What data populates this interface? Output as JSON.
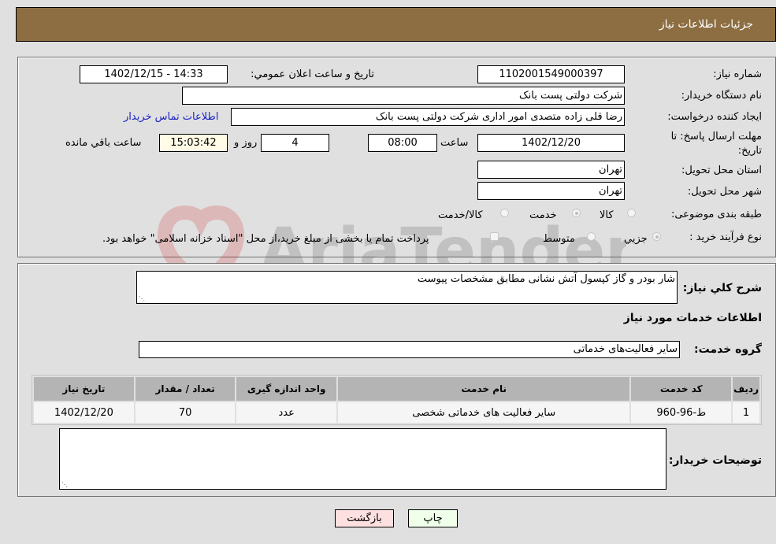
{
  "header": {
    "title": "جزئیات اطلاعات نیاز"
  },
  "form": {
    "need_number": {
      "label": "شماره نیاز:",
      "value": "1102001549000397"
    },
    "announce_datetime": {
      "label": "تاریخ و ساعت اعلان عمومي:",
      "value": "1402/12/15 - 14:33"
    },
    "buyer_org": {
      "label": "نام دستگاه خريدار:",
      "value": "شركت دولتی پست بانک"
    },
    "requester": {
      "label": "ایجاد کننده درخواست:",
      "value": "رضا قلی زاده متصدی امور اداری شرکت دولتی پست بانک"
    },
    "buyer_contact_link": "اطلاعات تماس خريدار",
    "deadline": {
      "label": "مهلت ارسال پاسخ: تا تاریخ:",
      "date": "1402/12/20",
      "time_label": "ساعت",
      "time": "08:00",
      "days": "4",
      "days_label": "روز و",
      "remaining": "15:03:42",
      "remaining_label": "ساعت باقي مانده"
    },
    "delivery_province": {
      "label": "استان محل تحويل:",
      "value": "تهران"
    },
    "delivery_city": {
      "label": "شهر محل تحويل:",
      "value": "تهران"
    },
    "category": {
      "label": "طبقه بندی موضوعی:",
      "options": [
        "کالا",
        "خدمت",
        "کالا/خدمت"
      ],
      "selected": "خدمت"
    },
    "purchase_type": {
      "label": "نوع فرآیند خرید :",
      "options": [
        "جزيي",
        "متوسط"
      ],
      "selected": "جزيي",
      "treasury_note": "پرداخت تمام یا بخشی از مبلغ خرید،از محل \"اسناد خزانه اسلامی\" خواهد بود.",
      "treasury_checked": false
    }
  },
  "details": {
    "description_label": "شرح کلي نياز:",
    "description_value": "شار بودر و گاز کپسول آتش نشانی مطابق مشخصات پیوست",
    "services_heading": "اطلاعات خدمات مورد نیاز",
    "service_group_label": "گروه خدمت:",
    "service_group_value": "سایر فعالیت‌های خدماتی",
    "table": {
      "headers": [
        "ردیف",
        "کد خدمت",
        "نام خدمت",
        "واحد اندازه گیری",
        "تعداد / مقدار",
        "تاریخ نیاز"
      ],
      "rows": [
        [
          "1",
          "ط-96-960",
          "سایر فعالیت های خدماتی شخصی",
          "عدد",
          "70",
          "1402/12/20"
        ]
      ]
    },
    "buyer_notes_label": "توضیحات خریدار:",
    "buyer_notes_value": ""
  },
  "buttons": {
    "print": "چاپ",
    "back": "بازگشت"
  },
  "watermark": "AriaTender.neT",
  "colors": {
    "header_bg": "#8d6e42",
    "link": "#1a22c4",
    "print_bg": "#efffea",
    "back_bg": "#ffe0e0"
  }
}
